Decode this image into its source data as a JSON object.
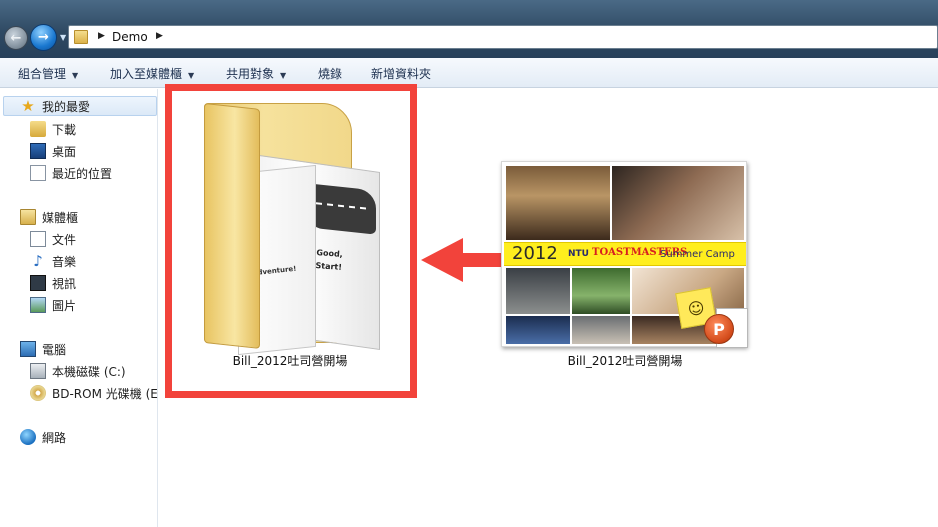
{
  "address_bar": {
    "location_label": "Demo",
    "back_icon": "back-arrow-icon",
    "forward_icon": "forward-arrow-icon"
  },
  "toolbar": {
    "organize_label": "組合管理",
    "include_in_library_label": "加入至媒體櫃",
    "share_with_label": "共用對象",
    "burn_label": "燒錄",
    "new_folder_label": "新增資料夾"
  },
  "navigation": {
    "favorites": {
      "label": "我的最愛",
      "items": [
        {
          "label": "下載",
          "icon": "downloads-icon"
        },
        {
          "label": "桌面",
          "icon": "desktop-icon"
        },
        {
          "label": "最近的位置",
          "icon": "recent-places-icon"
        }
      ]
    },
    "libraries": {
      "label": "媒體櫃",
      "items": [
        {
          "label": "文件",
          "icon": "documents-icon"
        },
        {
          "label": "音樂",
          "icon": "music-icon"
        },
        {
          "label": "視訊",
          "icon": "videos-icon"
        },
        {
          "label": "圖片",
          "icon": "pictures-icon"
        }
      ]
    },
    "computer": {
      "label": "電腦",
      "items": [
        {
          "label": "本機磁碟 (C:)",
          "icon": "local-disk-icon"
        },
        {
          "label": "BD-ROM 光碟機 (E:",
          "icon": "bd-rom-drive-icon"
        }
      ]
    },
    "network": {
      "label": "網路"
    }
  },
  "content": {
    "folder": {
      "name": "Bill_2012吐司營開場",
      "preview_text_right": "Good,\nStart!",
      "preview_text_left": "Adventure!"
    },
    "presentation_file": {
      "name": "Bill_2012吐司營開場",
      "banner_year": "2012",
      "banner_ntu": "NTU",
      "banner_org": "TOASTMASTERS",
      "banner_event": "Summer Camp"
    }
  },
  "colors": {
    "highlight_border": "#f2433b",
    "arrow": "#f2433b",
    "address_bar_bg": "#2f4a63",
    "toolbar_text": "#1e3150"
  }
}
